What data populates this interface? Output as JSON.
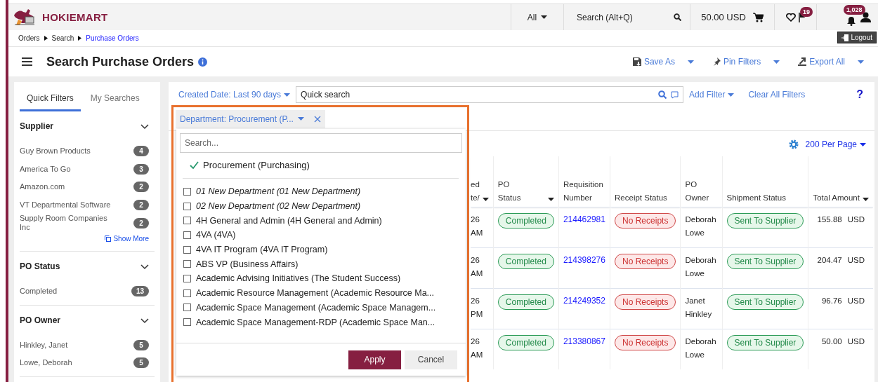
{
  "header": {
    "brand": "HOKIEMART",
    "scope": "All",
    "search_placeholder": "Search (Alt+Q)",
    "cart_total": "50.00 USD",
    "flag_count": "19",
    "notification_count": "1,028"
  },
  "breadcrumbs": [
    {
      "label": "Orders",
      "current": false
    },
    {
      "label": "Search",
      "current": false
    },
    {
      "label": "Purchase Orders",
      "current": true
    }
  ],
  "logout": "Logout",
  "page_title": "Search Purchase Orders",
  "actions": [
    "Save As",
    "Pin Filters",
    "Export All"
  ],
  "sidebar": {
    "tabs": [
      {
        "label": "Quick Filters",
        "selected": true
      },
      {
        "label": "My Searches",
        "selected": false
      }
    ],
    "sections": [
      {
        "title": "Supplier",
        "expanded": true,
        "items": [
          {
            "label": "Guy Brown Products",
            "count": "4"
          },
          {
            "label": "America To Go",
            "count": "3"
          },
          {
            "label": "Amazon.com",
            "count": "2"
          },
          {
            "label": "VT Departmental Software",
            "count": "2"
          },
          {
            "label": "Supply Room Companies Inc",
            "count": "2"
          }
        ],
        "more": "Show More"
      },
      {
        "title": "PO Status",
        "expanded": true,
        "items": [
          {
            "label": "Completed",
            "count": "13"
          }
        ]
      },
      {
        "title": "PO Owner",
        "expanded": true,
        "items": [
          {
            "label": "Hinkley, Janet",
            "count": "5"
          },
          {
            "label": "Lowe, Deborah",
            "count": "5"
          }
        ]
      }
    ]
  },
  "filters": {
    "date_filter": "Created Date: Last 90 days",
    "quick_search": {
      "placeholder": "Quick search"
    },
    "add_filter": "Add Filter",
    "clear_all": "Clear All Filters",
    "help": "?",
    "chip": "Department: Procurement (P..."
  },
  "department_dropdown": {
    "search_placeholder": "Search...",
    "selected": [
      {
        "label": "Procurement (Purchasing)"
      }
    ],
    "options": [
      {
        "label": "01 New Department (01 New Department)",
        "checked": false,
        "inactive": true
      },
      {
        "label": "02 New Department (02 New Department)",
        "checked": false,
        "inactive": true
      },
      {
        "label": "4H General and Admin (4H General and Admin)",
        "checked": false,
        "inactive": false
      },
      {
        "label": "4VA (4VA)",
        "checked": false,
        "inactive": false
      },
      {
        "label": "4VA IT Program (4VA IT Program)",
        "checked": false,
        "inactive": false
      },
      {
        "label": "ABS VP (Business Affairs)",
        "checked": false,
        "inactive": false
      },
      {
        "label": "Academic Advising Initiatives (The Student Success)",
        "checked": false,
        "inactive": false
      },
      {
        "label": "Academic Resource Management (Academic Resource Ma...",
        "checked": false,
        "inactive": false
      },
      {
        "label": "Academic Space Management (Academic Space Managem...",
        "checked": false,
        "inactive": false
      },
      {
        "label": "Academic Space Management-RDP (Academic Space Man...",
        "checked": false,
        "inactive": false
      }
    ],
    "buttons": [
      "Apply",
      "Cancel"
    ]
  },
  "table": {
    "per_page": "200 Per Page",
    "columns": [
      {
        "lines": [
          "ed",
          "te/"
        ],
        "sortable": true
      },
      {
        "lines": [
          "PO",
          "Status"
        ],
        "sortable": true
      },
      {
        "lines": [
          "Requisition",
          "Number"
        ],
        "sortable": false
      },
      {
        "lines": [
          "Receipt Status"
        ],
        "sortable": false
      },
      {
        "lines": [
          "PO",
          "Owner"
        ],
        "sortable": false
      },
      {
        "lines": [
          "Shipment Status"
        ],
        "sortable": false
      },
      {
        "lines": [
          "Total Amount"
        ],
        "sortable": true
      }
    ],
    "rows": [
      {
        "column_1": [
          "26",
          "AM"
        ],
        "po_status": "Completed",
        "requisition": "214462981",
        "receipt_status": "No Receipts",
        "owner": "Deborah Lowe",
        "shipment_status": "Sent To Supplier",
        "amount": "155.88",
        "currency": "USD"
      },
      {
        "column_1": [
          "26",
          "AM"
        ],
        "po_status": "Completed",
        "requisition": "214398276",
        "receipt_status": "No Receipts",
        "owner": "Deborah Lowe",
        "shipment_status": "Sent To Supplier",
        "amount": "204.47",
        "currency": "USD"
      },
      {
        "column_1": [
          "26",
          "PM"
        ],
        "po_status": "Completed",
        "requisition": "214249352",
        "receipt_status": "No Receipts",
        "owner": "Janet Hinkley",
        "shipment_status": "Sent To Supplier",
        "amount": "96.76",
        "currency": "USD"
      },
      {
        "column_1": [
          "26",
          "AM"
        ],
        "po_status": "Completed",
        "requisition": "213380867",
        "receipt_status": "No Receipts",
        "owner": "Deborah Lowe",
        "shipment_status": "Sent To Supplier",
        "amount": "50.00",
        "currency": "USD"
      }
    ]
  }
}
